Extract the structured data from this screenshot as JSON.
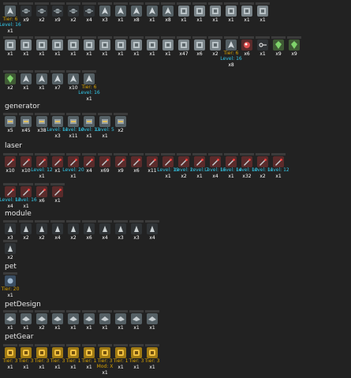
{
  "colors": {
    "background": "#222222",
    "tier": "#d8a200",
    "level": "#33c7e7",
    "text": "#ffffff"
  },
  "top": {
    "row1": [
      {
        "icon": "ship-icon",
        "tier": "Tier: 6",
        "level": "Level: 16",
        "count": "x1"
      },
      {
        "icon": "drone-icon",
        "count": "x9"
      },
      {
        "icon": "drone-icon",
        "count": "x2"
      },
      {
        "icon": "drone-icon",
        "count": "x9"
      },
      {
        "icon": "drone-icon",
        "count": "x2"
      },
      {
        "icon": "drone-icon",
        "count": "x4"
      },
      {
        "icon": "ship-icon",
        "count": "x3"
      },
      {
        "icon": "ship-icon",
        "count": "x1"
      },
      {
        "icon": "ship-icon",
        "count": "x8"
      },
      {
        "icon": "ship-icon",
        "count": "x1"
      },
      {
        "icon": "ship-icon",
        "count": "x8"
      },
      {
        "icon": "box-icon",
        "count": "x1"
      },
      {
        "icon": "box-icon",
        "count": "x1"
      },
      {
        "icon": "box-icon",
        "count": "x1"
      },
      {
        "icon": "box-icon",
        "count": "x1"
      },
      {
        "icon": "box-icon",
        "count": "x1"
      },
      {
        "icon": "box-icon",
        "count": "x1"
      }
    ],
    "row2": [
      {
        "icon": "box-icon",
        "count": "x1"
      },
      {
        "icon": "box-icon",
        "count": "x1"
      },
      {
        "icon": "box-icon",
        "count": "x1"
      },
      {
        "icon": "box-icon",
        "count": "x1"
      },
      {
        "icon": "box-icon",
        "count": "x1"
      },
      {
        "icon": "box-icon",
        "count": "x1"
      },
      {
        "icon": "box-icon",
        "count": "x1"
      },
      {
        "icon": "box-icon",
        "count": "x1"
      },
      {
        "icon": "box-icon",
        "count": "x1"
      },
      {
        "icon": "box-icon",
        "count": "x1"
      },
      {
        "icon": "box-icon",
        "count": "x1"
      },
      {
        "icon": "box-icon",
        "count": "x47"
      },
      {
        "icon": "box-icon",
        "count": "x6"
      },
      {
        "icon": "box-icon",
        "count": "x2"
      },
      {
        "icon": "ship-icon",
        "tier": "Tier: 6",
        "level": "Level: 16",
        "count": "x8"
      },
      {
        "icon": "orb-icon",
        "count": "x6"
      },
      {
        "icon": "key-icon",
        "count": "x1"
      },
      {
        "icon": "gem-icon",
        "count": "x9"
      },
      {
        "icon": "gem-icon",
        "count": "x9"
      }
    ],
    "row3": [
      {
        "icon": "gem-icon",
        "count": "x2"
      },
      {
        "icon": "ship-icon",
        "count": "x1"
      },
      {
        "icon": "ship-icon",
        "count": "x1"
      },
      {
        "icon": "ship-icon",
        "count": "x7"
      },
      {
        "icon": "ship-icon",
        "count": "x10"
      },
      {
        "icon": "ship-icon",
        "tier": "Tier: 6",
        "level": "Level: 16",
        "count": "x1"
      }
    ]
  },
  "generator": {
    "title": "generator",
    "items": [
      {
        "icon": "generator-icon",
        "count": "x5"
      },
      {
        "icon": "generator-icon",
        "count": "x45"
      },
      {
        "icon": "generator-icon",
        "count": "x38"
      },
      {
        "icon": "generator-icon",
        "level": "Level: 11",
        "count": "x3"
      },
      {
        "icon": "generator-icon",
        "level": "Level: 10",
        "count": "x11"
      },
      {
        "icon": "generator-icon",
        "level": "Level: 13",
        "count": "x1"
      },
      {
        "icon": "generator-icon",
        "level": "Level: 5",
        "count": "x1"
      },
      {
        "icon": "generator-icon",
        "count": "x2"
      }
    ]
  },
  "laser": {
    "title": "laser",
    "row1": [
      {
        "icon": "laser-icon",
        "count": "x10"
      },
      {
        "icon": "laser-icon",
        "count": "x10"
      },
      {
        "icon": "laser-icon",
        "level": "Level: 12",
        "count": "x1"
      },
      {
        "icon": "laser-icon",
        "count": "x1"
      },
      {
        "icon": "laser-icon",
        "level": "Level: 20",
        "count": "x1"
      },
      {
        "icon": "laser-icon",
        "count": "x4"
      },
      {
        "icon": "laser-icon",
        "count": "x69"
      },
      {
        "icon": "laser-icon",
        "count": "x9"
      },
      {
        "icon": "laser-icon",
        "count": "x6"
      },
      {
        "icon": "laser-icon",
        "count": "x11"
      },
      {
        "icon": "laser-icon",
        "level": "Level: 19",
        "count": "x1"
      },
      {
        "icon": "laser-icon",
        "level": "Level: 2",
        "count": "x2"
      },
      {
        "icon": "laser-icon",
        "level": "Level: 7",
        "count": "x1"
      },
      {
        "icon": "laser-icon",
        "level": "Level: 15",
        "count": "x4"
      },
      {
        "icon": "laser-icon",
        "level": "Level: 14",
        "count": "x1"
      },
      {
        "icon": "laser-icon",
        "level": "Level: 10",
        "count": "x32"
      },
      {
        "icon": "laser-icon",
        "level": "Level: 11",
        "count": "x2"
      },
      {
        "icon": "laser-icon",
        "level": "Level: 12",
        "count": "x1"
      }
    ],
    "row2": [
      {
        "icon": "laser-icon",
        "level": "Level: 13",
        "count": "x4"
      },
      {
        "icon": "laser-icon",
        "level": "Level: 16",
        "count": "x1"
      },
      {
        "icon": "laser-icon",
        "count": "x6"
      },
      {
        "icon": "laser-icon",
        "count": "x1"
      }
    ]
  },
  "module": {
    "title": "module",
    "row1": [
      {
        "icon": "module-icon",
        "count": "x3"
      },
      {
        "icon": "module-icon",
        "count": "x2"
      },
      {
        "icon": "module-icon",
        "count": "x2"
      },
      {
        "icon": "module-icon",
        "count": "x4"
      },
      {
        "icon": "module-icon",
        "count": "x2"
      },
      {
        "icon": "module-icon",
        "count": "x6"
      },
      {
        "icon": "module-icon",
        "count": "x4"
      },
      {
        "icon": "module-icon",
        "count": "x3"
      },
      {
        "icon": "module-icon",
        "count": "x3"
      },
      {
        "icon": "module-icon",
        "count": "x4"
      }
    ],
    "row2": [
      {
        "icon": "module-icon",
        "count": "x2"
      }
    ]
  },
  "pet": {
    "title": "pet",
    "items": [
      {
        "icon": "pet-icon",
        "tier": "Tier: 20",
        "count": "x1"
      }
    ]
  },
  "petDesign": {
    "title": "petDesign",
    "items": [
      {
        "icon": "pet-design-icon",
        "count": "x1"
      },
      {
        "icon": "pet-design-icon",
        "count": "x1"
      },
      {
        "icon": "pet-design-icon",
        "count": "x2"
      },
      {
        "icon": "pet-design-icon",
        "count": "x1"
      },
      {
        "icon": "pet-design-icon",
        "count": "x1"
      },
      {
        "icon": "pet-design-icon",
        "count": "x1"
      },
      {
        "icon": "pet-design-icon",
        "count": "x1"
      },
      {
        "icon": "pet-design-icon",
        "count": "x1"
      },
      {
        "icon": "pet-design-icon",
        "count": "x1"
      },
      {
        "icon": "pet-design-icon",
        "count": "x1"
      }
    ]
  },
  "petGear": {
    "title": "petGear",
    "items": [
      {
        "icon": "pet-gear-icon",
        "tier": "Tier: 3",
        "count": "x1"
      },
      {
        "icon": "pet-gear-icon",
        "tier": "Tier: 3",
        "count": "x1"
      },
      {
        "icon": "pet-gear-icon",
        "tier": "Tier: 3",
        "count": "x1"
      },
      {
        "icon": "pet-gear-icon",
        "tier": "Tier: 3",
        "count": "x1"
      },
      {
        "icon": "pet-gear-icon",
        "tier": "Tier: 1",
        "count": "x1"
      },
      {
        "icon": "pet-gear-icon",
        "tier": "Tier: 1",
        "count": "x1"
      },
      {
        "icon": "pet-gear-icon",
        "tier": "Tier: 3",
        "mod": "Mod: X",
        "count": "x1"
      },
      {
        "icon": "pet-gear-icon",
        "tier": "Tier: 1",
        "count": "x1"
      },
      {
        "icon": "pet-gear-icon",
        "tier": "Tier: 3",
        "count": "x1"
      },
      {
        "icon": "pet-gear-icon",
        "tier": "Tier: 3",
        "count": "x1"
      }
    ]
  }
}
